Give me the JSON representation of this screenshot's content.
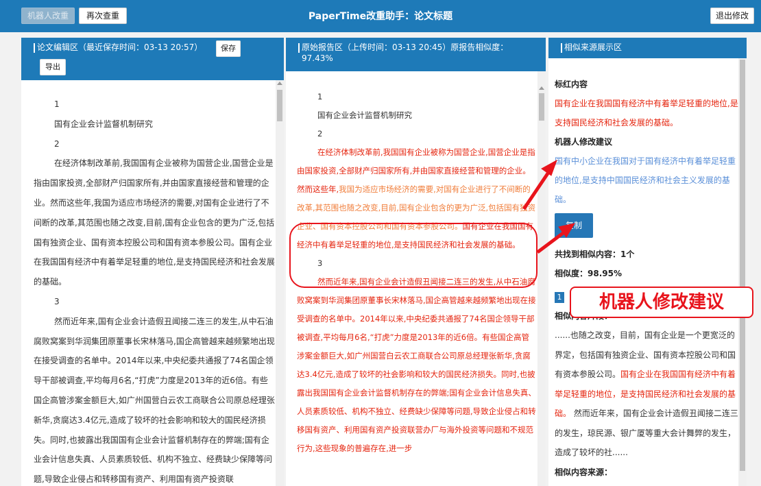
{
  "topbar": {
    "robot_btn": "机器人改重",
    "recheck_btn": "再次查重",
    "title": "PaperTime改重助手：论文标题",
    "exit_btn": "退出修改"
  },
  "left_panel": {
    "title": "论文编辑区（最近保存时间：03-13 20:57）",
    "save_btn": "保存",
    "export_btn": "导出",
    "lines": [
      "1",
      "国有企业会计监督机制研究",
      "2",
      "在经济体制改革前,我国国有企业被称为国营企业,国营企业是指由国家投资,全部财产归国家所有,并由国家直接经营和管理的企业。然而这些年,我国为适应市场经济的需要,对国有企业进行了不间断的改革,其范围也随之改变,目前,国有企业包含的更为广泛,包括国有独资企业、国有资本控股公司和国有资本参股公司。国有企业在我国国有经济中有着举足轻重的地位,是支持国民经济和社会发展的基础。",
      "3",
      "然而近年来,国有企业会计造假丑闻接二连三的发生,从中石油腐败窝案到华润集团原董事长宋林落马,国企高管越来越频繁地出现在接受调查的名单中。2014年以来,中央纪委共通报了74名国企领导干部被调查,平均每月6名,“打虎”力度是2013年的近6倍。有些国企高管涉案金额巨大,如广州国营白云农工商联合公司原总经理张新华,贪腐达3.4亿元,造成了较坏的社会影响和较大的国民经济损失。同时,也披露出我国国有企业会计监督机制存在的弊端;国有企业会计信息失真、人员素质较低、机构不独立、经费缺少保障等问题,导致企业侵占和转移国有资产、利用国有资产投资联"
    ]
  },
  "mid_panel": {
    "title": "原始报告区（上传时间：03-13 20:45）原报告相似度：97.43%",
    "n1": "1",
    "heading": "国有企业会计监督机制研究",
    "n2": "2",
    "p2_red1": "在经济体制改革前,我国国有企业被称为国营企业,国营企业是指由国家投资,全部财产归国家所有,并由国家直接经营和管理的企业。然而这些年,",
    "p2_orange": "我国为适应市场经济的需要,对国有企业进行了不间断的改革,其范围也随之改变,目前,国有企业包含的更为广泛,包括国有独资企业、国有资本控股公司和国有资本参股公司。",
    "p2_red2": "国有企业在我国国有经济中有着举足轻重的地位,是支持国民经济和社会发展的基础。",
    "n3": "3",
    "p3_red": "然而近年来,国有企业会计造假丑闻接二连三的发生,从中石油腐败窝案到华润集团原董事长宋林落马,国企高管越来越频繁地出现在接受调查的名单中。2014年以来,中央纪委共通报了74名国企领导干部被调查,平均每月6名,“打虎”力度是2013年的近6倍。有些国企高管涉案金额巨大,如广州国营白云农工商联合公司原总经理张新华,贪腐达3.4亿元,造成了较坏的社会影响和较大的国民经济损失。同时,也披露出我国国有企业会计监督机制存在的弊端;国有企业会计信息失真、人员素质较低、机构不独立、经费缺少保障等问题,导致企业侵占和转移国有资产、利用国有资产投资联营办厂与海外投资等问题和不规范行为,这些现象的普遍存在,进一步"
  },
  "right_panel": {
    "title": "相似来源展示区",
    "marked_label": "标红内容",
    "marked_text": "国有企业在我国国有经济中有着举足轻重的地位,是支持国民经济和社会发展的基础。",
    "suggest_label": "机器人修改建议",
    "suggest_text": "国有中小企业在我国对于国有经济中有着举足轻重的地位,是支持中国国民经济和社会主义发展的基础。",
    "copy_btn": "复制",
    "found_label": "共找到相似内容：1个",
    "similarity_label": "相似度：98.95%",
    "page_num": "1",
    "fragment_label": "相似内容片段：",
    "frag_before": "......也随之改变，目前，国有企业是一个更宽泛的界定，包括国有独资企业、国有资本控股公司和国有资本参股公司。",
    "frag_red": "国有企业在我国国有经济中有着举足轻重的地位，是支持国民经济和社会发展的基础。",
    "frag_after": " 然而近年来，国有企业会计造假丑闻接二连三的发生，琼民源、银广厦等重大会计舞弊的发生，造成了较坏的社......",
    "source_label": "相似内容来源："
  },
  "annotation": {
    "callout_text": "机器人修改建议",
    "color": "#e8141c"
  }
}
